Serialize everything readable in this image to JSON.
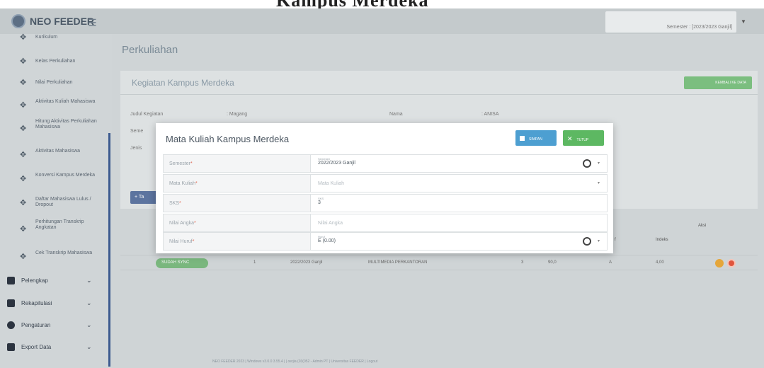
{
  "doc_title": "Kampus Merdeka",
  "app": {
    "name": "NEO FEEDER",
    "semester_label": "Semester : [2023/2023 Ganjil]"
  },
  "sidebar": {
    "items": [
      {
        "label": "Kurikulum"
      },
      {
        "label": "Kelas Perkuliahan"
      },
      {
        "label": "Nilai Perkuliahan"
      },
      {
        "label": "Aktivitas Kuliah Mahasiswa"
      },
      {
        "label": "Hitung Aktivitas Perkuliahan Mahasiswa"
      },
      {
        "label": "Aktivitas Mahasiswa"
      },
      {
        "label": "Konversi Kampus Merdeka"
      },
      {
        "label": "Daftar Mahasiswa Lulus / Dropout"
      },
      {
        "label": "Perhitungan Transkrip Angkatan"
      },
      {
        "label": "Cek Transkrip Mahasiswa"
      }
    ],
    "groups": [
      {
        "label": "Pelengkap"
      },
      {
        "label": "Rekapitulasi"
      },
      {
        "label": "Pengaturan"
      },
      {
        "label": "Export Data"
      }
    ]
  },
  "main": {
    "page_title": "Perkuliahan",
    "card_title": "Kegiatan Kampus Merdeka",
    "back_button": "KEMBALI KE DATA",
    "info": {
      "judul_label": "Judul Kegiatan",
      "judul_value": ": Magang",
      "nama_label": "Nama",
      "nama_value": ": ANISA",
      "semester_label": "Seme",
      "jenis_label": "Jenis"
    },
    "add_button": "+ Ta",
    "table": {
      "header_aksi": "Aksi",
      "header_indeks": "Indeks",
      "header_f": "f",
      "row": {
        "status": "SUDAH SYNC",
        "no": "1",
        "semester": "2022/2023 Ganjil",
        "mata_kuliah": "MULTIMEDIA PERKANTORAN",
        "sks": "3",
        "nilai_angka": "90,0",
        "nilai_huruf": "A",
        "indeks": "4,00"
      }
    },
    "footer": "NEO FEEDER 2023 | Windows v3.0.0 3.55.4 | | oerjia (03(052 - Admin PT | Universitas FEEDER | Logout"
  },
  "modal": {
    "title": "Mata Kuliah Kampus Merdeka",
    "save_button": "SIMPAN",
    "close_button": "TUTUP",
    "fields": [
      {
        "label": "Semester",
        "mini": "Semester",
        "value": "2022/2023 Ganjil",
        "placeholder": ""
      },
      {
        "label": "Mata Kuliah",
        "mini": "",
        "value": "",
        "placeholder": "Mata Kuliah"
      },
      {
        "label": "SKS",
        "mini": "SKS",
        "value": "3",
        "placeholder": ""
      },
      {
        "label": "Nilai Angka",
        "mini": "",
        "value": "",
        "placeholder": "Nilai Angka"
      },
      {
        "label": "Nilai Huruf",
        "mini": "Huruf",
        "value": "E (0.00)",
        "placeholder": ""
      }
    ]
  },
  "colors": {
    "primary": "#3c5a8f",
    "success": "#5db862",
    "info": "#4d9fd1",
    "danger": "#e0553d",
    "warning": "#e5a63a"
  }
}
